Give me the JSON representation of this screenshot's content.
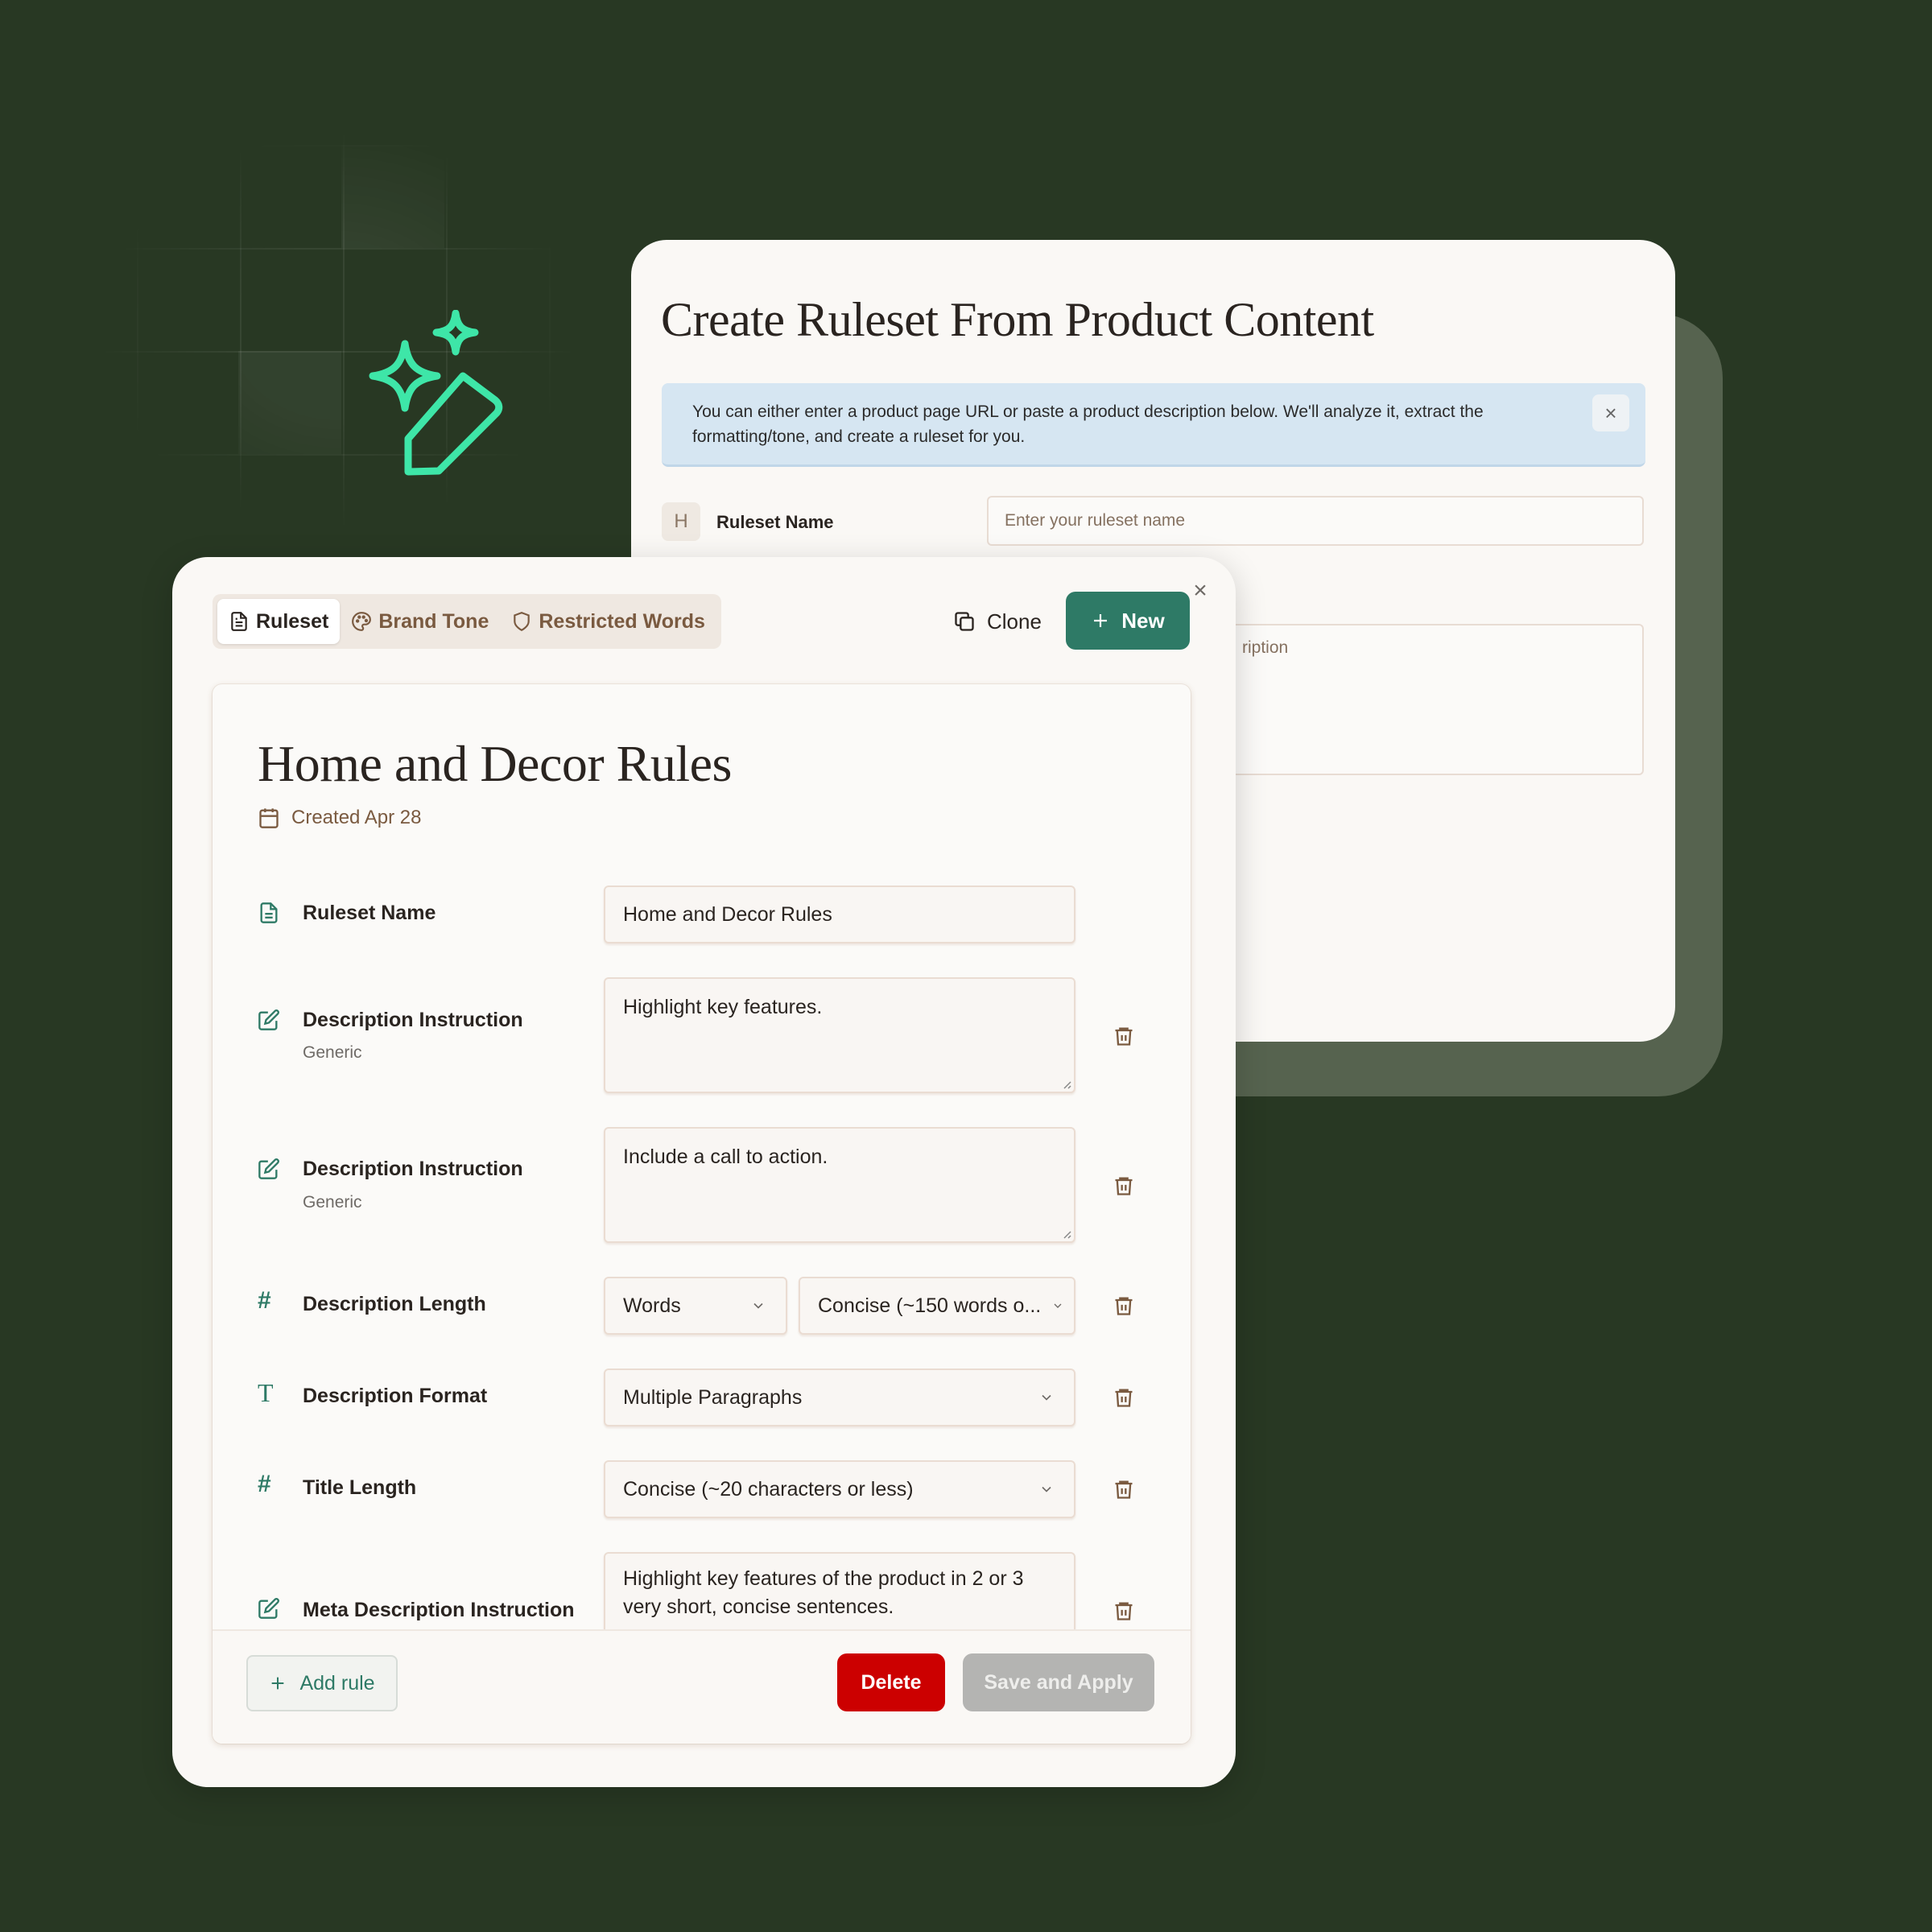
{
  "back_panel": {
    "title": "Create Ruleset From Product Content",
    "info_text": "You can either enter a product page URL or paste a product description below. We'll analyze it, extract the formatting/tone, and create a ruleset for you.",
    "info_close": "×",
    "name_badge": "H",
    "name_label": "Ruleset Name",
    "name_placeholder": "Enter your ruleset name",
    "description_placeholder_visible": "ription"
  },
  "tabs": [
    {
      "label": "Ruleset",
      "icon": "document-icon",
      "active": true
    },
    {
      "label": "Brand Tone",
      "icon": "palette-icon",
      "active": false
    },
    {
      "label": "Restricted Words",
      "icon": "shield-icon",
      "active": false
    }
  ],
  "toolbar": {
    "clone_label": "Clone",
    "new_label": "New",
    "close": "×"
  },
  "ruleset": {
    "title": "Home and Decor Rules",
    "created": "Created Apr 28"
  },
  "rules": {
    "name": {
      "label": "Ruleset Name",
      "value": "Home and Decor Rules"
    },
    "desc1": {
      "label": "Description Instruction",
      "sub": "Generic",
      "value": "Highlight key features."
    },
    "desc2": {
      "label": "Description Instruction",
      "sub": "Generic",
      "value": "Include a call to action."
    },
    "length": {
      "label": "Description Length",
      "unit": "Words",
      "value": "Concise (~150 words o..."
    },
    "format": {
      "label": "Description Format",
      "value": "Multiple Paragraphs"
    },
    "title_length": {
      "label": "Title Length",
      "value": "Concise (~20 characters or less)"
    },
    "meta": {
      "label": "Meta Description Instruction",
      "value": "Highlight key features of the product in 2 or 3 very short, concise sentences."
    }
  },
  "footer": {
    "add_rule": "Add rule",
    "delete": "Delete",
    "save": "Save and Apply"
  },
  "colors": {
    "background": "#283823",
    "accent": "#2e7a66",
    "danger": "#cc0000",
    "sparkle": "#3ee6a8"
  }
}
